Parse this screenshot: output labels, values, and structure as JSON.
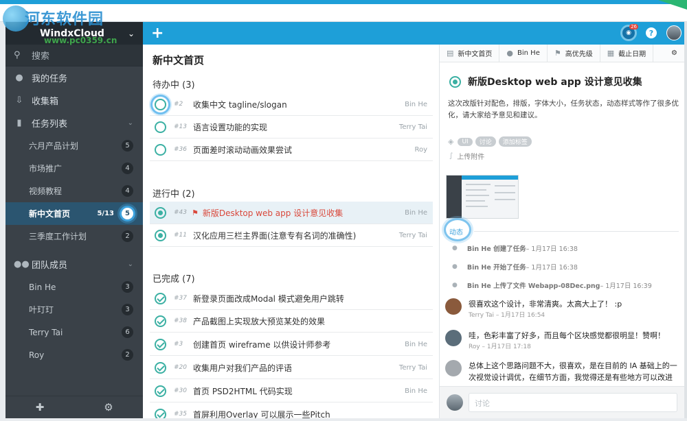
{
  "watermark": {
    "title": "河东软件园",
    "url": "www.pc0359.cn"
  },
  "sidebar": {
    "brand": "WindxCloud",
    "search": "搜索",
    "my_tasks": "我的任务",
    "inbox": "收集箱",
    "task_lists": "任务列表",
    "lists": [
      {
        "label": "六月产品计划",
        "badge": "5"
      },
      {
        "label": "市场推广",
        "badge": "4"
      },
      {
        "label": "视频教程",
        "badge": "4"
      },
      {
        "label": "新中文首页",
        "count": "5/13",
        "badge": "5"
      },
      {
        "label": "三季度工作计划",
        "badge": "2"
      }
    ],
    "team": "团队成员",
    "members": [
      {
        "label": "Bin He",
        "badge": "3"
      },
      {
        "label": "叶玎玎",
        "badge": "3"
      },
      {
        "label": "Terry Tai",
        "badge": "6"
      },
      {
        "label": "Roy",
        "badge": "2"
      }
    ]
  },
  "middle": {
    "plus": "+",
    "title": "新中文首页",
    "sections": {
      "todo": "待办中 (3)",
      "progress": "进行中 (2)",
      "done": "已完成 (7)"
    },
    "todo": [
      {
        "num": "#2",
        "title": "收集中文 tagline/slogan",
        "who": "Bin He"
      },
      {
        "num": "#13",
        "title": "语言设置功能的实现",
        "who": "Terry Tai"
      },
      {
        "num": "#36",
        "title": "页面差时滚动动画效果尝试",
        "who": "Roy"
      }
    ],
    "progress": [
      {
        "num": "#43",
        "title": "新版Desktop web app 设计意见收集",
        "who": "Bin He"
      },
      {
        "num": "#11",
        "title": "汉化应用三栏主界面(注意专有名词的准确性)",
        "who": "Terry Tai"
      }
    ],
    "done": [
      {
        "num": "#37",
        "title": "新登录页面改成Modal 模式避免用户跳转",
        "who": ""
      },
      {
        "num": "#38",
        "title": "产品截图上实现放大预览某处的效果",
        "who": ""
      },
      {
        "num": "#3",
        "title": "创建首页 wireframe 以供设计师参考",
        "who": "Bin He"
      },
      {
        "num": "#20",
        "title": "收集用户对我们产品的评语",
        "who": "Terry Tai"
      },
      {
        "num": "#30",
        "title": "首页 PSD2HTML 代码实现",
        "who": "Bin He"
      },
      {
        "num": "#35",
        "title": "首屏利用Overlay 可以展示一些Pitch",
        "who": ""
      }
    ]
  },
  "header": {
    "notif_count": "26",
    "help": "?"
  },
  "detail": {
    "meta": {
      "list": "新中文首页",
      "assignee": "Bin He",
      "priority": "高优先级",
      "due": "截止日期"
    },
    "title": "新版Desktop web app 设计意见收集",
    "description": "这次改版针对配色，排版，字体大小，任务状态，动态样式等作了很多优化，请大家给予意见和建议。",
    "tags": [
      "UI",
      "讨论",
      "添加标签"
    ],
    "attach": "上传附件",
    "activity_label": "动态",
    "activities": [
      {
        "actor": "Bin He 创建了任务",
        "time": " – 1月17日 16:38"
      },
      {
        "actor": "Bin He 开始了任务",
        "time": " – 1月17日 16:38"
      },
      {
        "actor": "Bin He 上传了文件 Webapp-08Dec.png",
        "time": " – 1月17日 16:39"
      }
    ],
    "comments": [
      {
        "text": "很喜欢这个设计，非常清爽。太高大上了！ :p",
        "meta": "Terry Tai – 1月17日 16:54",
        "color": "#8a5a3c"
      },
      {
        "text": "哇，色彩丰富了好多，而且每个区块感觉都很明显！赞啊！",
        "meta": "Roy – 1月17日 17:18",
        "color": "#5b6d7a"
      },
      {
        "text": "总体上这个思路问题不大，很喜欢，是在目前的 IA 基础上的一次视觉设计调优，在细节方面，我觉得还是有些地方可以改进",
        "meta": "",
        "color": "#a4a9ae"
      }
    ],
    "discuss_placeholder": "讨论"
  },
  "colors": {
    "accent": "#1e9fd8",
    "sidebar": "#3a4148",
    "status": "#3bb0a3",
    "flag": "#d9483b"
  }
}
